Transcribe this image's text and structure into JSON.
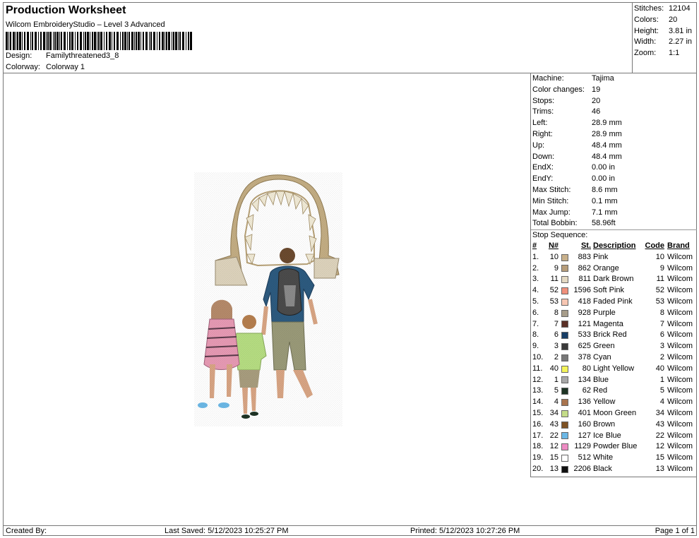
{
  "header": {
    "title": "Production Worksheet",
    "software": "Wilcom EmbroideryStudio – Level 3 Advanced",
    "design_label": "Design:",
    "design_value": "Familythreatened3_8",
    "colorway_label": "Colorway:",
    "colorway_value": "Colorway 1"
  },
  "summary": [
    {
      "label": "Stitches:",
      "value": "12104"
    },
    {
      "label": "Colors:",
      "value": "20"
    },
    {
      "label": "Height:",
      "value": "3.81 in"
    },
    {
      "label": "Width:",
      "value": "2.27 in"
    },
    {
      "label": "Zoom:",
      "value": "1:1"
    }
  ],
  "machine_info": [
    {
      "label": "Machine:",
      "value": "Tajima"
    },
    {
      "label": "Color changes:",
      "value": "19"
    },
    {
      "label": "Stops:",
      "value": "20"
    },
    {
      "label": "Trims:",
      "value": "46"
    },
    {
      "label": "Left:",
      "value": "28.9 mm"
    },
    {
      "label": "Right:",
      "value": "28.9 mm"
    },
    {
      "label": "Up:",
      "value": "48.4 mm"
    },
    {
      "label": "Down:",
      "value": "48.4 mm"
    },
    {
      "label": "EndX:",
      "value": "0.00 in"
    },
    {
      "label": "EndY:",
      "value": "0.00 in"
    },
    {
      "label": "Max Stitch:",
      "value": "8.6 mm"
    },
    {
      "label": "Min Stitch:",
      "value": "0.1 mm"
    },
    {
      "label": "Max Jump:",
      "value": "7.1 mm"
    },
    {
      "label": "Total Bobbin:",
      "value": "58.96ft"
    }
  ],
  "stop_sequence": {
    "title": "Stop Sequence:",
    "headers": {
      "idx": "#",
      "n": "N#",
      "st": "St.",
      "desc": "Description",
      "code": "Code",
      "brand": "Brand"
    },
    "rows": [
      {
        "idx": "1.",
        "n": "10",
        "color": "#c8b08a",
        "st": "883",
        "desc": "Pink",
        "code": "10",
        "brand": "Wilcom"
      },
      {
        "idx": "2.",
        "n": "9",
        "color": "#b79d7a",
        "st": "862",
        "desc": "Orange",
        "code": "9",
        "brand": "Wilcom"
      },
      {
        "idx": "3.",
        "n": "11",
        "color": "#e4d9c2",
        "st": "811",
        "desc": "Dark Brown",
        "code": "11",
        "brand": "Wilcom"
      },
      {
        "idx": "4.",
        "n": "52",
        "color": "#f0907c",
        "st": "1596",
        "desc": "Soft Pink",
        "code": "52",
        "brand": "Wilcom"
      },
      {
        "idx": "5.",
        "n": "53",
        "color": "#f7c6b2",
        "st": "418",
        "desc": "Faded Pink",
        "code": "53",
        "brand": "Wilcom"
      },
      {
        "idx": "6.",
        "n": "8",
        "color": "#a79d8a",
        "st": "928",
        "desc": "Purple",
        "code": "8",
        "brand": "Wilcom"
      },
      {
        "idx": "7.",
        "n": "7",
        "color": "#5a2f26",
        "st": "121",
        "desc": "Magenta",
        "code": "7",
        "brand": "Wilcom"
      },
      {
        "idx": "8.",
        "n": "6",
        "color": "#173e66",
        "st": "533",
        "desc": "Brick Red",
        "code": "6",
        "brand": "Wilcom"
      },
      {
        "idx": "9.",
        "n": "3",
        "color": "#3a3a3a",
        "st": "625",
        "desc": "Green",
        "code": "3",
        "brand": "Wilcom"
      },
      {
        "idx": "10.",
        "n": "2",
        "color": "#777777",
        "st": "378",
        "desc": "Cyan",
        "code": "2",
        "brand": "Wilcom"
      },
      {
        "idx": "11.",
        "n": "40",
        "color": "#f4f45a",
        "st": "80",
        "desc": "Light Yellow",
        "code": "40",
        "brand": "Wilcom"
      },
      {
        "idx": "12.",
        "n": "1",
        "color": "#a8a8a8",
        "st": "134",
        "desc": "Blue",
        "code": "1",
        "brand": "Wilcom"
      },
      {
        "idx": "13.",
        "n": "5",
        "color": "#1d3324",
        "st": "62",
        "desc": "Red",
        "code": "5",
        "brand": "Wilcom"
      },
      {
        "idx": "14.",
        "n": "4",
        "color": "#a9744e",
        "st": "136",
        "desc": "Yellow",
        "code": "4",
        "brand": "Wilcom"
      },
      {
        "idx": "15.",
        "n": "34",
        "color": "#c4dc88",
        "st": "401",
        "desc": "Moon Green",
        "code": "34",
        "brand": "Wilcom"
      },
      {
        "idx": "16.",
        "n": "43",
        "color": "#7e5224",
        "st": "160",
        "desc": "Brown",
        "code": "43",
        "brand": "Wilcom"
      },
      {
        "idx": "17.",
        "n": "22",
        "color": "#6cb8e6",
        "st": "127",
        "desc": "Ice Blue",
        "code": "22",
        "brand": "Wilcom"
      },
      {
        "idx": "18.",
        "n": "12",
        "color": "#ee8cc4",
        "st": "1129",
        "desc": "Powder Blue",
        "code": "12",
        "brand": "Wilcom"
      },
      {
        "idx": "19.",
        "n": "15",
        "color": "#ffffff",
        "st": "512",
        "desc": "White",
        "code": "15",
        "brand": "Wilcom"
      },
      {
        "idx": "20.",
        "n": "13",
        "color": "#101010",
        "st": "2206",
        "desc": "Black",
        "code": "13",
        "brand": "Wilcom"
      }
    ]
  },
  "footer": {
    "created_by": "Created By:",
    "last_saved": "Last Saved: 5/12/2023 10:25:27 PM",
    "printed": "Printed: 5/12/2023 10:27:26 PM",
    "page": "Page 1 of 1"
  }
}
